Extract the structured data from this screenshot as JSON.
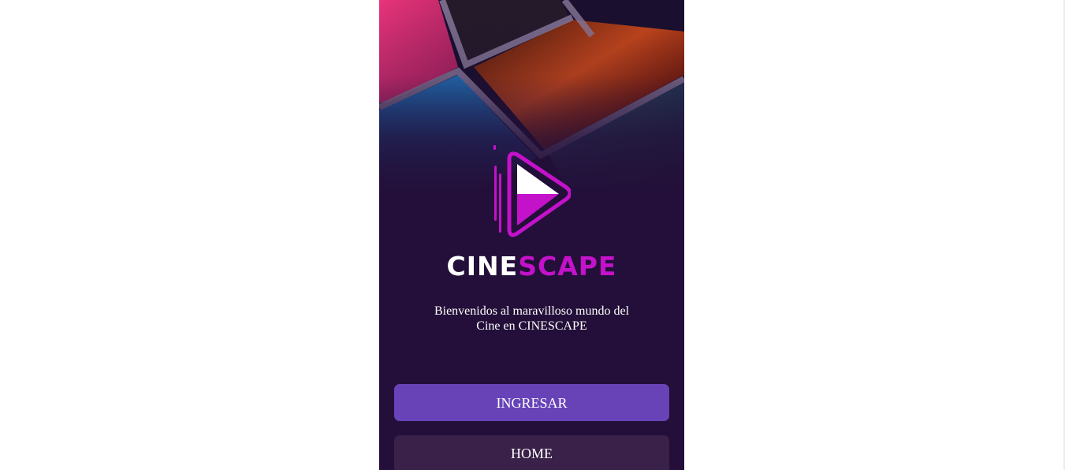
{
  "brand": {
    "name_part1": "CINE",
    "name_part2": "SCAPE",
    "logo_icon": "play-film-logo-icon",
    "accent_color": "#c312c9"
  },
  "welcome": {
    "line1": "Bienvenidos al maravilloso mundo del",
    "line2": "Cine en CINESCAPE"
  },
  "buttons": {
    "ingresar_label": "INGRESAR",
    "home_label": "HOME"
  },
  "colors": {
    "background": "#230f39",
    "primary_button": "#6843b8",
    "secondary_button": "#3a2149"
  }
}
